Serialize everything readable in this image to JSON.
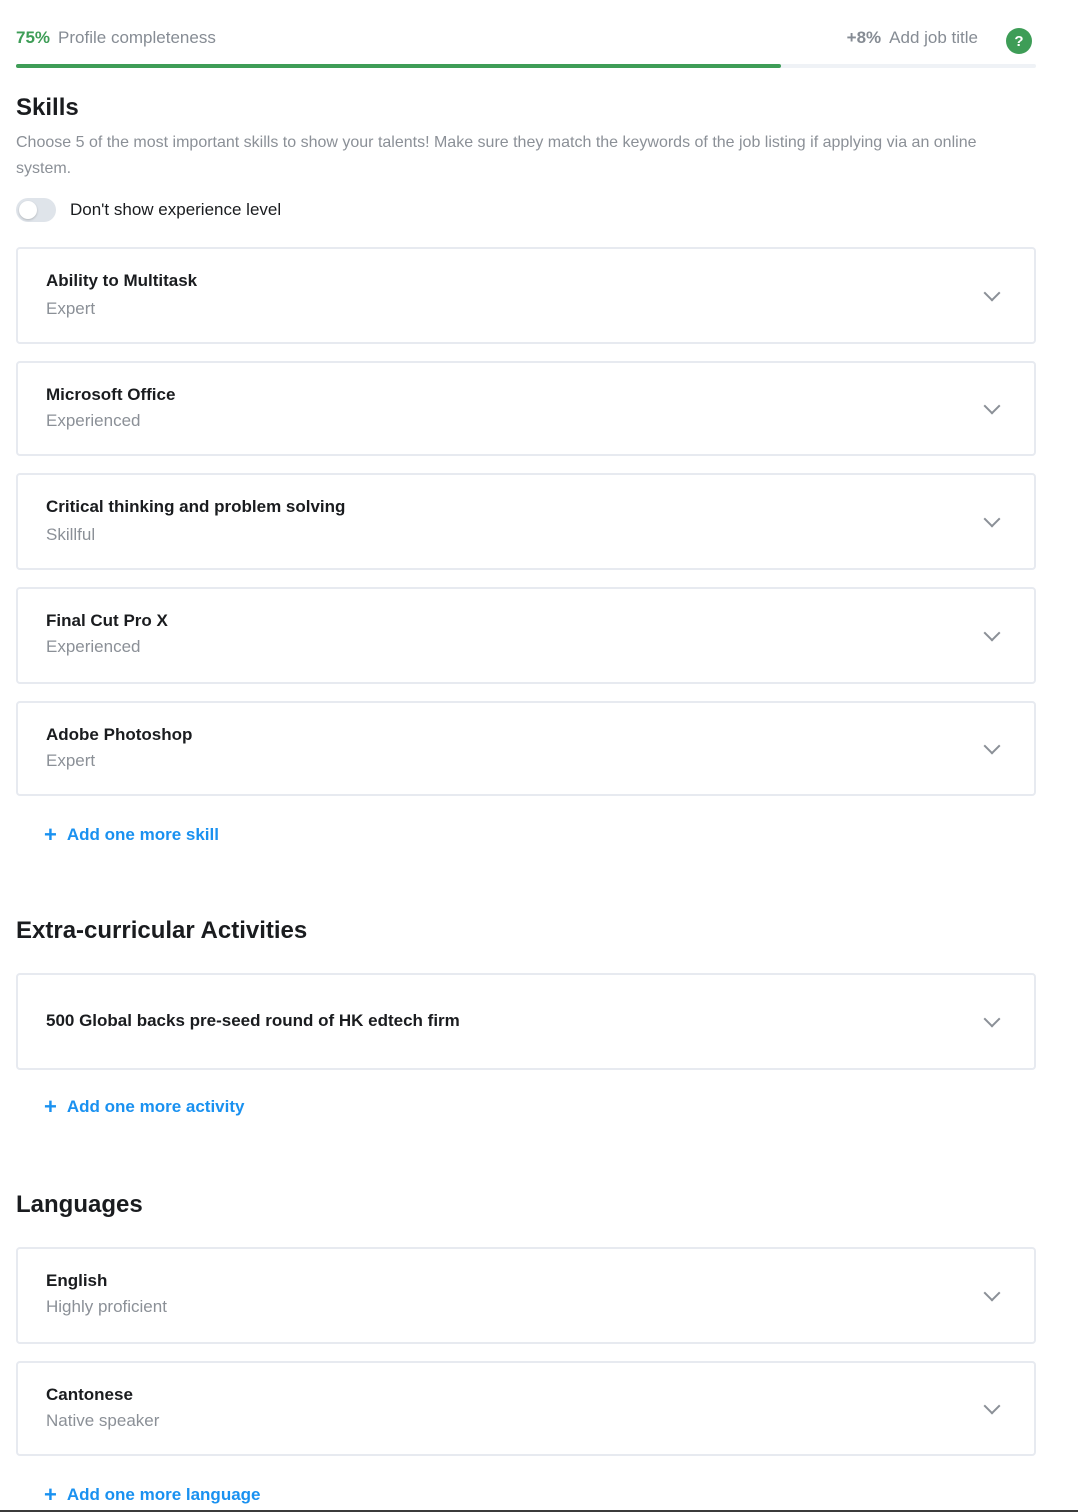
{
  "progress": {
    "percent_label": "75%",
    "label": "Profile completeness",
    "fraction": 0.75,
    "bonus_percent": "+8%",
    "bonus_label": "Add job title",
    "help_icon": "?",
    "accent_color": "#3e9d57"
  },
  "skills": {
    "title": "Skills",
    "description": "Choose 5 of the most important skills to show your talents! Make sure they match the keywords of the job listing if applying via an online system.",
    "toggle_label": "Don't show experience level",
    "toggle_on": false,
    "items": [
      {
        "name": "Ability to Multitask",
        "level": "Expert"
      },
      {
        "name": "Microsoft Office",
        "level": "Experienced"
      },
      {
        "name": "Critical thinking and problem solving",
        "level": "Skillful"
      },
      {
        "name": "Final Cut Pro X",
        "level": "Experienced"
      },
      {
        "name": "Adobe Photoshop",
        "level": "Expert"
      }
    ],
    "add_label": "Add one more skill"
  },
  "activities": {
    "title": "Extra-curricular Activities",
    "items": [
      {
        "name": "500 Global backs pre-seed round of HK edtech firm"
      }
    ],
    "add_label": "Add one more activity"
  },
  "languages": {
    "title": "Languages",
    "items": [
      {
        "name": "English",
        "level": "Highly proficient"
      },
      {
        "name": "Cantonese",
        "level": "Native speaker"
      }
    ],
    "add_label": "Add one more language"
  },
  "icons": {
    "plus": "+",
    "chevron": "chevron-down-icon"
  },
  "link_color": "#1a91f0"
}
